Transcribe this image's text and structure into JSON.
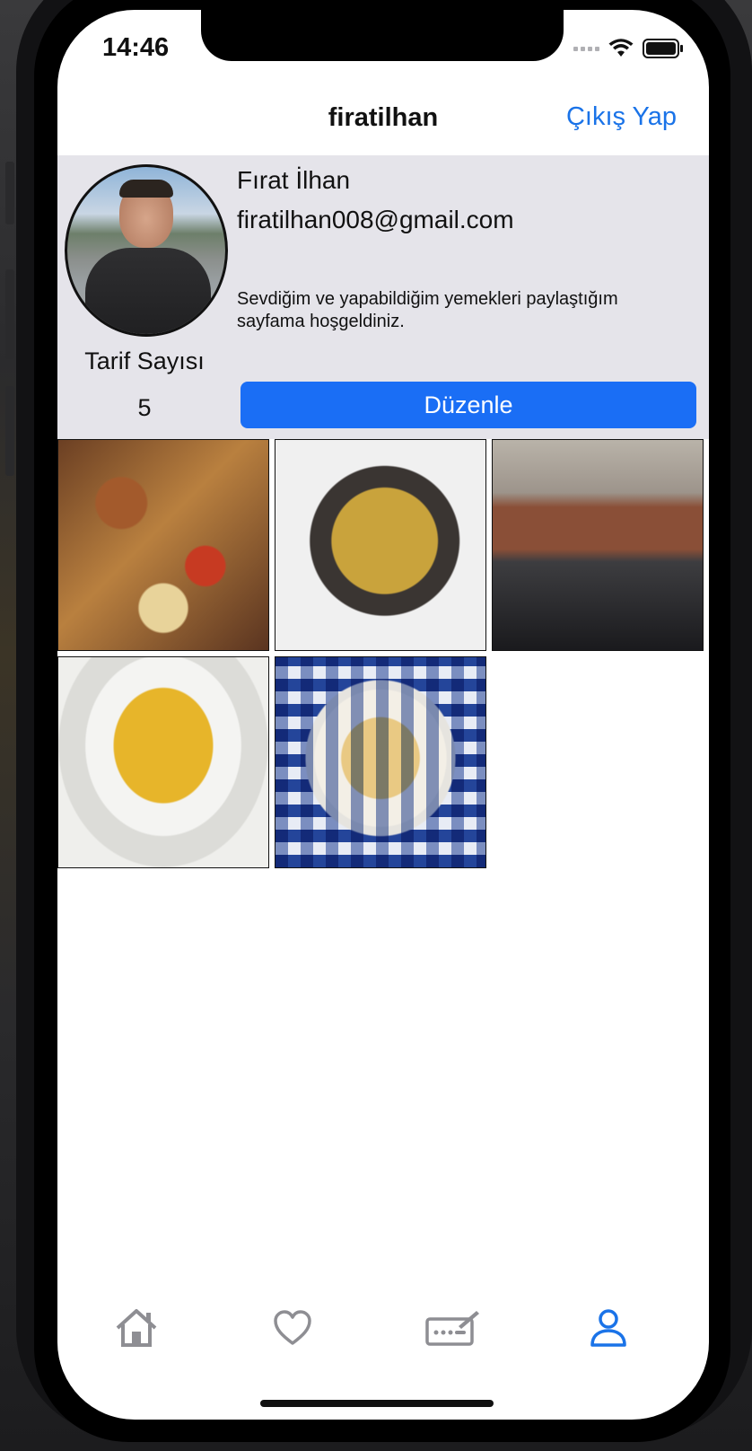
{
  "status_bar": {
    "time": "14:46"
  },
  "nav": {
    "title": "firatilhan",
    "logout_label": "Çıkış Yap"
  },
  "profile": {
    "full_name": "Fırat İlhan",
    "email": "firatilhan008@gmail.com",
    "bio": "Sevdiğim ve yapabildiğim yemekleri paylaştığım sayfama hoşgeldiniz.",
    "recipe_count_label": "Tarif Sayısı",
    "recipe_count": "5",
    "edit_label": "Düzenle"
  },
  "recipes": [
    {
      "icon": "roasted-chicken-vegetables-photo"
    },
    {
      "icon": "pan-fried-potatoes-photo"
    },
    {
      "icon": "oven-baked-tray-photo"
    },
    {
      "icon": "lentil-soup-bowl-photo"
    },
    {
      "icon": "soup-plate-checkered-cloth-photo"
    }
  ],
  "tabs": [
    {
      "name": "home",
      "icon": "home-icon",
      "active": false
    },
    {
      "name": "favorites",
      "icon": "heart-icon",
      "active": false
    },
    {
      "name": "add-recipe",
      "icon": "keyboard-pen-icon",
      "active": false
    },
    {
      "name": "profile",
      "icon": "person-icon",
      "active": true
    }
  ],
  "colors": {
    "accent": "#1a73e8",
    "button": "#1a6ef5",
    "header_bg": "#e5e4ea",
    "inactive_icon": "#8e8e93"
  }
}
